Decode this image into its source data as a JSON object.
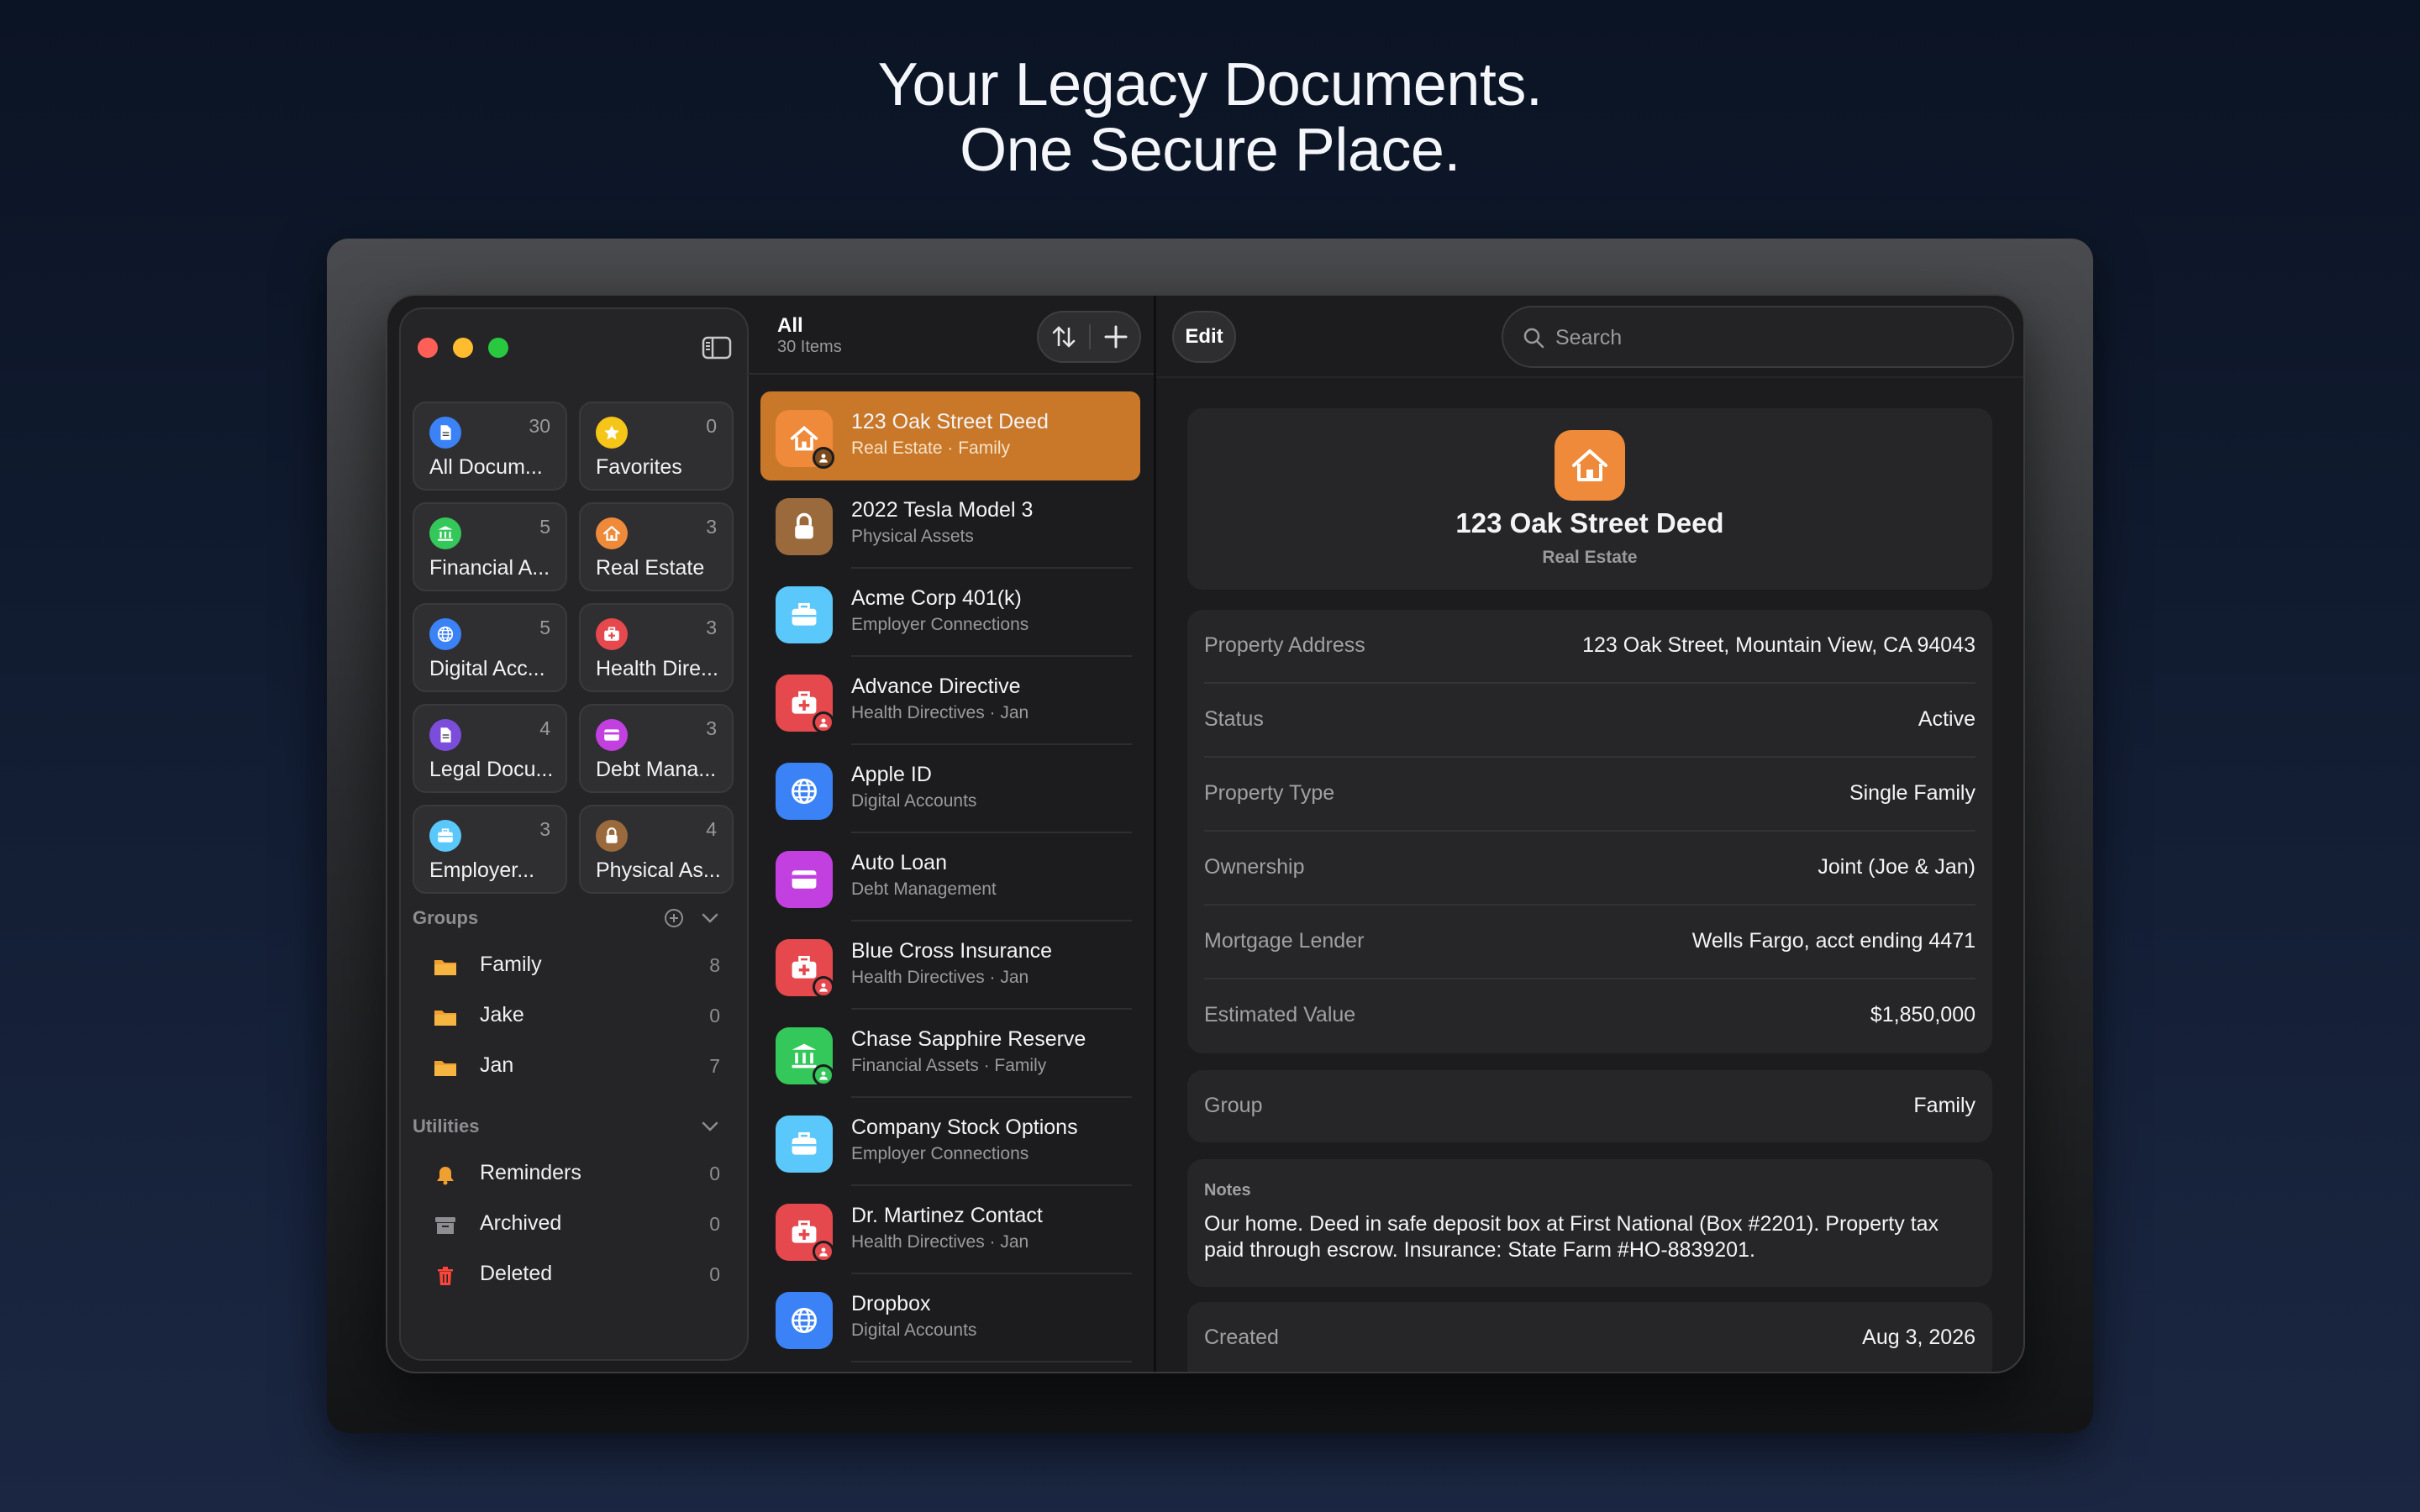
{
  "headline": {
    "line1": "Your Legacy Documents.",
    "line2": "One Secure Place."
  },
  "colors": {
    "accent": "#c9782a",
    "background": "#0b1424",
    "window": "#1c1c1e"
  },
  "sidebar": {
    "cards": [
      {
        "label": "All Docum...",
        "count": "30",
        "icon": "document-icon",
        "color": "#3b82f6"
      },
      {
        "label": "Favorites",
        "count": "0",
        "icon": "star-icon",
        "color": "#f5c518"
      },
      {
        "label": "Financial A...",
        "count": "5",
        "icon": "bank-icon",
        "color": "#34c759"
      },
      {
        "label": "Real Estate",
        "count": "3",
        "icon": "house-icon",
        "color": "#ee8a3a"
      },
      {
        "label": "Digital Acc...",
        "count": "5",
        "icon": "globe-icon",
        "color": "#3b82f6"
      },
      {
        "label": "Health Dire...",
        "count": "3",
        "icon": "medical-kit-icon",
        "color": "#e5484d"
      },
      {
        "label": "Legal Docu...",
        "count": "4",
        "icon": "document-icon",
        "color": "#7c4ddb"
      },
      {
        "label": "Debt Mana...",
        "count": "3",
        "icon": "credit-card-icon",
        "color": "#c23fe0"
      },
      {
        "label": "Employer...",
        "count": "3",
        "icon": "briefcase-icon",
        "color": "#5ac8fa"
      },
      {
        "label": "Physical As...",
        "count": "4",
        "icon": "lock-icon",
        "color": "#9b6a3c"
      }
    ],
    "groups": {
      "heading": "Groups",
      "items": [
        {
          "label": "Family",
          "count": "8"
        },
        {
          "label": "Jake",
          "count": "0"
        },
        {
          "label": "Jan",
          "count": "7"
        }
      ]
    },
    "utilities": {
      "heading": "Utilities",
      "items": [
        {
          "label": "Reminders",
          "count": "0",
          "icon": "bell-icon"
        },
        {
          "label": "Archived",
          "count": "0",
          "icon": "archive-box-icon"
        },
        {
          "label": "Deleted",
          "count": "0",
          "icon": "trash-icon"
        }
      ]
    }
  },
  "list": {
    "title": "All",
    "subtitle": "30 Items",
    "items": [
      {
        "title": "123 Oak Street Deed",
        "subtitle": "Real Estate · Family",
        "icon": "house-icon",
        "color": "#ee8a3a",
        "badge": "#7a4a1c",
        "selected": true
      },
      {
        "title": "2022 Tesla Model 3",
        "subtitle": "Physical Assets",
        "icon": "lock-icon",
        "color": "#9b6a3c"
      },
      {
        "title": "Acme Corp 401(k)",
        "subtitle": "Employer Connections",
        "icon": "briefcase-icon",
        "color": "#5ac8fa"
      },
      {
        "title": "Advance Directive",
        "subtitle": "Health Directives · Jan",
        "icon": "medical-kit-icon",
        "color": "#e5484d",
        "badge": "#e5484d"
      },
      {
        "title": "Apple ID",
        "subtitle": "Digital Accounts",
        "icon": "globe-icon",
        "color": "#3b82f6"
      },
      {
        "title": "Auto Loan",
        "subtitle": "Debt Management",
        "icon": "credit-card-icon",
        "color": "#c23fe0"
      },
      {
        "title": "Blue Cross Insurance",
        "subtitle": "Health Directives · Jan",
        "icon": "medical-kit-icon",
        "color": "#e5484d",
        "badge": "#e5484d"
      },
      {
        "title": "Chase Sapphire Reserve",
        "subtitle": "Financial Assets · Family",
        "icon": "bank-icon",
        "color": "#34c759",
        "badge": "#34c759"
      },
      {
        "title": "Company Stock Options",
        "subtitle": "Employer Connections",
        "icon": "briefcase-icon",
        "color": "#5ac8fa"
      },
      {
        "title": "Dr. Martinez Contact",
        "subtitle": "Health Directives · Jan",
        "icon": "medical-kit-icon",
        "color": "#e5484d",
        "badge": "#e5484d"
      },
      {
        "title": "Dropbox",
        "subtitle": "Digital Accounts",
        "icon": "globe-icon",
        "color": "#3b82f6"
      }
    ]
  },
  "detail": {
    "edit_label": "Edit",
    "search_placeholder": "Search",
    "title": "123 Oak Street Deed",
    "category": "Real Estate",
    "fields": [
      {
        "key": "Property Address",
        "value": "123 Oak Street, Mountain View, CA 94043"
      },
      {
        "key": "Status",
        "value": "Active"
      },
      {
        "key": "Property Type",
        "value": "Single Family"
      },
      {
        "key": "Ownership",
        "value": "Joint (Joe & Jan)"
      },
      {
        "key": "Mortgage Lender",
        "value": "Wells Fargo, acct ending 4471"
      },
      {
        "key": "Estimated Value",
        "value": "$1,850,000"
      }
    ],
    "group": {
      "key": "Group",
      "value": "Family"
    },
    "notes": {
      "key": "Notes",
      "value": "Our home. Deed in safe deposit box at First National (Box #2201). Property tax paid through escrow. Insurance: State Farm #HO-8839201."
    },
    "created": {
      "key": "Created",
      "value": "Aug 3, 2026"
    }
  }
}
